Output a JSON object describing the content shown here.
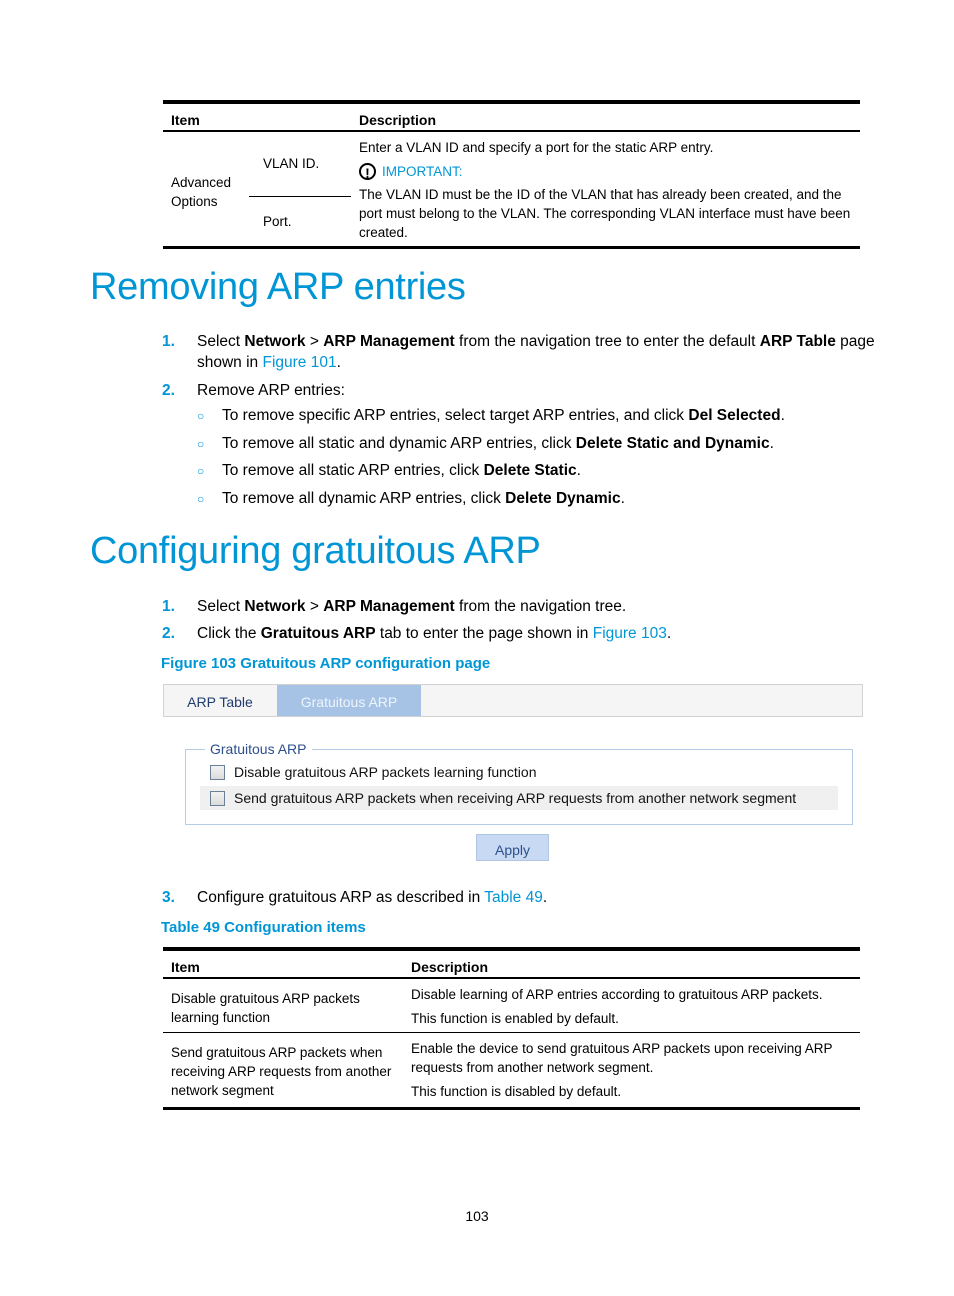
{
  "top_table": {
    "headers": [
      "Item",
      "Description"
    ],
    "group_label": "Advanced Options",
    "rows": [
      {
        "item": "VLAN ID."
      },
      {
        "item": "Port."
      }
    ],
    "description_line1": "Enter a VLAN ID and specify a port for the static ARP entry.",
    "important_label": "IMPORTANT:",
    "important_icon": "exclamation-circle-icon",
    "description_line2": "The VLAN ID must be the ID of the VLAN that has already been created, and the port must belong to the VLAN. The corresponding VLAN interface must have been created."
  },
  "section1": {
    "title": "Removing ARP entries",
    "steps": [
      {
        "num": "1.",
        "parts": [
          "Select ",
          "Network",
          " > ",
          "ARP Management",
          " from the navigation tree to enter the default ",
          "ARP Table",
          " page"
        ],
        "line2_pre": "shown in ",
        "line2_link": "Figure 101",
        "line2_post": "."
      },
      {
        "num": "2.",
        "text": "Remove ARP entries:"
      }
    ],
    "bullets": [
      {
        "pre": "To remove specific ARP entries, select target ARP entries, and click ",
        "bold": "Del Selected",
        "post": "."
      },
      {
        "pre": "To remove all static and dynamic ARP entries, click ",
        "bold": "Delete Static and Dynamic",
        "post": "."
      },
      {
        "pre": "To remove all static ARP entries, click ",
        "bold": "Delete Static",
        "post": "."
      },
      {
        "pre": "To remove all dynamic ARP entries, click ",
        "bold": "Delete Dynamic",
        "post": "."
      }
    ]
  },
  "section2": {
    "title": "Configuring gratuitous ARP",
    "steps": [
      {
        "num": "1.",
        "pre": "Select ",
        "b1": "Network",
        "mid": " > ",
        "b2": "ARP Management",
        "post": " from the navigation tree."
      },
      {
        "num": "2.",
        "pre": "Click the ",
        "b1": "Gratuitous ARP",
        "mid": " tab to enter the page shown in ",
        "link": "Figure 103",
        "post": "."
      },
      {
        "num": "3.",
        "pre": "Configure gratuitous ARP as described in ",
        "link": "Table 49",
        "post": "."
      }
    ],
    "figure_caption": "Figure 103 Gratuitous ARP configuration page",
    "table_caption": "Table 49 Configuration items"
  },
  "ui_figure": {
    "tabs": [
      {
        "label": "ARP Table",
        "active": false
      },
      {
        "label": "Gratuitous ARP",
        "active": true
      }
    ],
    "fieldset_legend": "Gratuitous ARP",
    "checkboxes": [
      {
        "label": "Disable gratuitous ARP packets learning function",
        "checked": false
      },
      {
        "label": "Send gratuitous ARP packets when receiving ARP requests from another network segment",
        "checked": false
      }
    ],
    "apply_label": "Apply"
  },
  "config_table": {
    "headers": [
      "Item",
      "Description"
    ],
    "rows": [
      {
        "item": "Disable gratuitous ARP packets learning function",
        "desc1": "Disable learning of ARP entries according to gratuitous ARP packets.",
        "desc2": "This function is enabled by default."
      },
      {
        "item": "Send gratuitous ARP packets when receiving ARP requests from another network segment",
        "desc1": "Enable the device to send gratuitous ARP packets upon receiving ARP requests from another network segment.",
        "desc2": "This function is disabled by default."
      }
    ]
  },
  "page_number": "103",
  "colors": {
    "heading_blue": "#0096d6",
    "tab_active_bg": "#a6c3e6",
    "apply_bg": "#c8daf3"
  }
}
